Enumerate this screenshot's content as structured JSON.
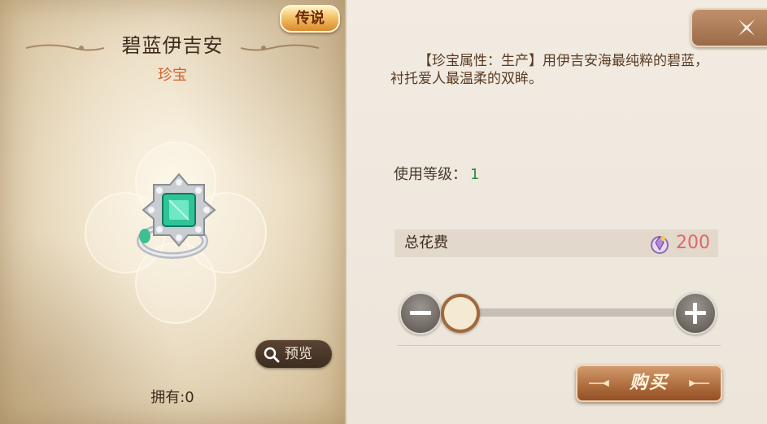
{
  "item": {
    "name": "碧蓝伊吉安",
    "type": "珍宝",
    "rarity": "传说",
    "owned_label": "拥有:0",
    "preview_label": "预览",
    "image": "emerald-ring-icon"
  },
  "details": {
    "description": "【珍宝属性：生产】用伊吉安海最纯粹的碧蓝，衬托爱人最温柔的双眸。",
    "level_label": "使用等级：",
    "level_value": "1"
  },
  "cost": {
    "label": "总花费",
    "value": "200",
    "currency_icon": "gem-coin-icon"
  },
  "quantity_slider": {
    "fraction": 0
  },
  "actions": {
    "buy_label": "购买",
    "close_icon": "close-icon"
  },
  "colors": {
    "rarity_badge": "#e8a040",
    "type_text": "#c8652e",
    "level_value": "#2a8a3a",
    "cost_value": "#e0676a",
    "buy_button": "#b06f40"
  }
}
